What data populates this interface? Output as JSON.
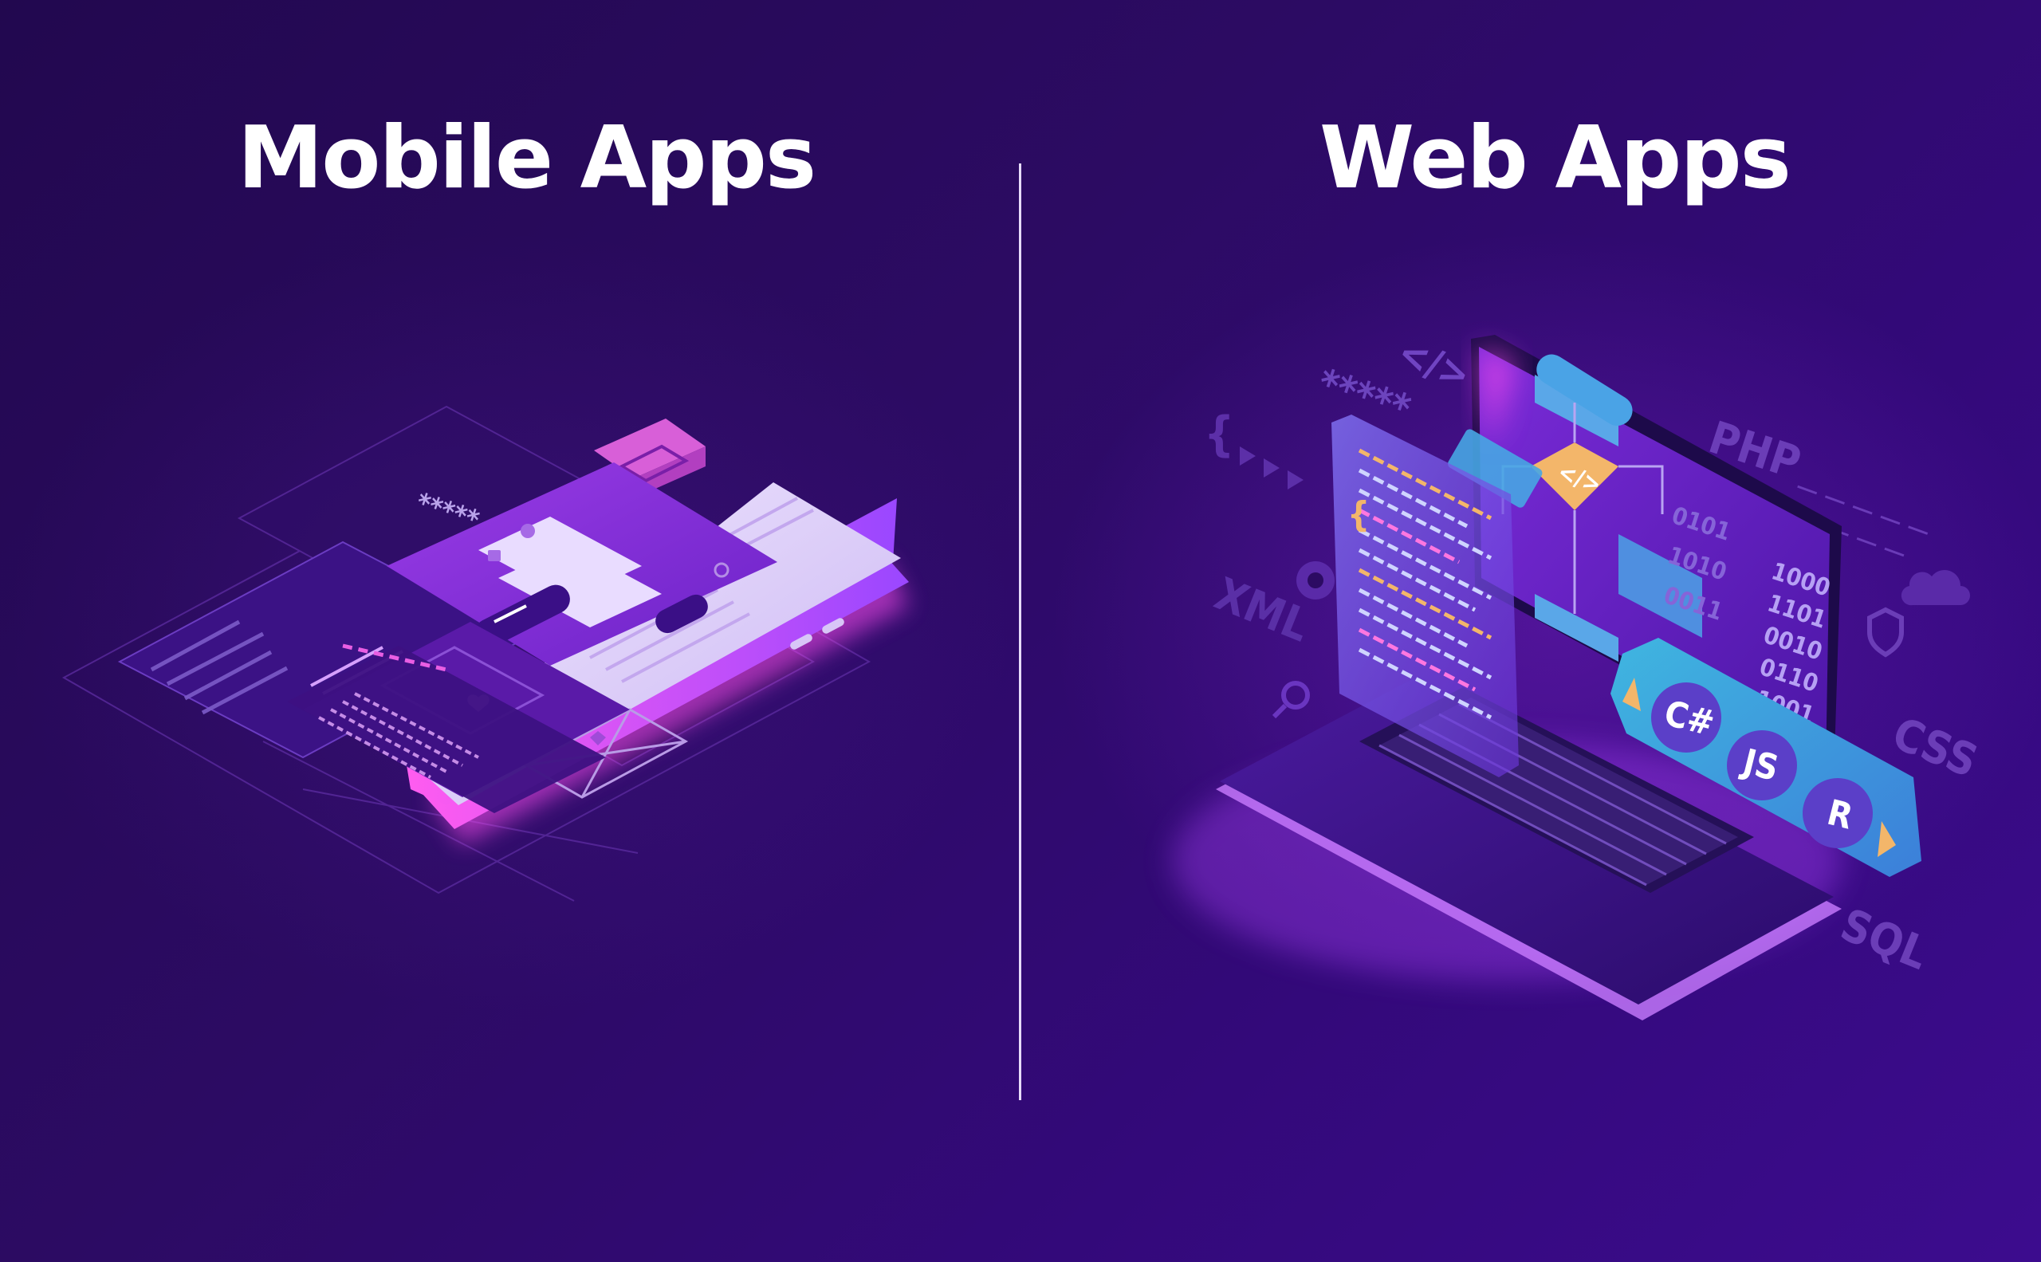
{
  "titles": {
    "mobile": "Mobile Apps",
    "web": "Web Apps"
  },
  "mobile_illustration": {
    "password_mask": "*****",
    "icons": [
      "user-icon",
      "lock-icon",
      "search-icon",
      "heart-icon",
      "arrow-icon"
    ]
  },
  "web_illustration": {
    "code_tag": "</>",
    "password_mask": "*****",
    "languages": [
      "C#",
      "JS",
      "R"
    ],
    "floating_labels": [
      "PHP",
      "XML",
      "CSS",
      "SQL"
    ],
    "binary_text": [
      "1000",
      "1101",
      "0010",
      "0110",
      "1001"
    ],
    "left_binary": [
      "0101",
      "1010",
      "0011"
    ],
    "icons": [
      "gear-icon",
      "search-icon",
      "shield-icon",
      "cloud-icon",
      "braces-icon"
    ]
  },
  "colors": {
    "background": "#2a0a5e",
    "title": "#ffffff",
    "divider": "#e7dcfb",
    "accent_magenta": "#e243e8",
    "accent_cyan": "#3fb6e0",
    "accent_orange": "#f3b66a"
  }
}
